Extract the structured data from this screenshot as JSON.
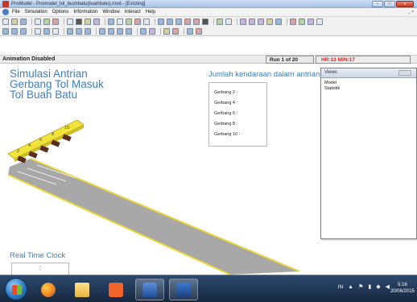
{
  "window": {
    "title": "ProModel - Promodel_tol_bushbatu(buahbatu).mod - [Existing]",
    "buttons": {
      "minimize": "–",
      "maximize": "□",
      "close": "x"
    }
  },
  "menu": {
    "items": [
      "File",
      "Simulation",
      "Options",
      "Information",
      "Window",
      "Interact",
      "Help"
    ],
    "mdi_controls": "_ ×"
  },
  "status": {
    "animation": "Animation Disabled",
    "run": "Run 1 of 20",
    "hr_label": "HR:",
    "hr_value": "13",
    "min_label": "MIN:",
    "min_value": "17"
  },
  "simulation": {
    "title_lines": [
      "Simulasi Antrian",
      "Gerbang Tol Masuk",
      "Tol Buah Batu"
    ],
    "queue_title": "Jumlah kendaraan dalam antrian",
    "counters": [
      "Gerbang 2 :",
      "Gerbang 4 :",
      "Gerbang 6 :",
      "Gerbang 8 :",
      "Gerbang 10 :"
    ],
    "gate_labels": [
      "2",
      "4",
      "6",
      "8",
      "10"
    ],
    "clock_label": "Real Time Clock",
    "clock_value": ":"
  },
  "views_panel": {
    "title": "Views",
    "items": [
      "Model",
      "Statistik"
    ]
  },
  "colors": {
    "accent_text": "#3f7ec3",
    "status_red": "#d81e1e",
    "gate_yellow": "#f3e43c",
    "road_gray": "#a8a8a8",
    "road_edge": "#e9d53a"
  },
  "taskbar": {
    "apps": [
      "start-orb",
      "firefox-icon",
      "folder-icon",
      "media-player-icon",
      "word-icon",
      "promodel-icon"
    ],
    "language": "IN",
    "time": "5:16",
    "date": "20/06/2015"
  }
}
